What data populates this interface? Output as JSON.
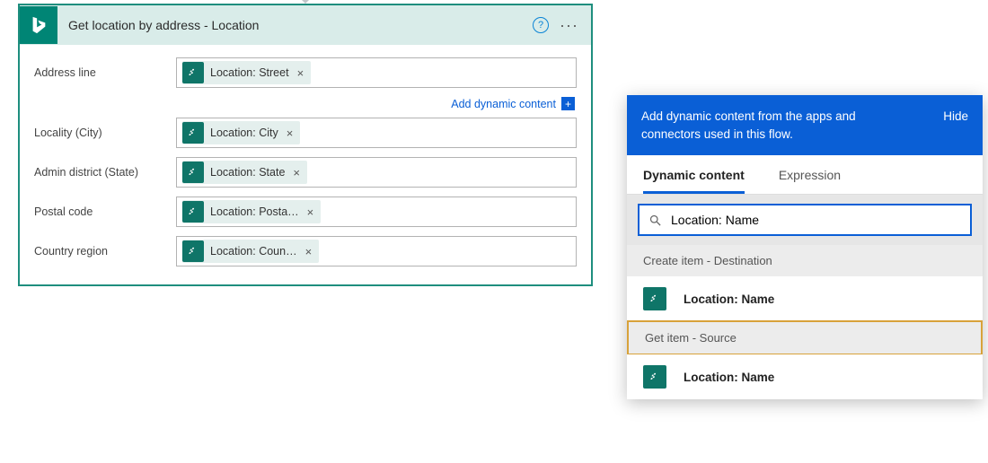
{
  "action": {
    "title": "Get location by address - Location",
    "fields": [
      {
        "label": "Address line",
        "token": "Location: Street"
      },
      {
        "label": "Locality (City)",
        "token": "Location: City"
      },
      {
        "label": "Admin district (State)",
        "token": "Location: State"
      },
      {
        "label": "Postal code",
        "token": "Location: Posta…"
      },
      {
        "label": "Country region",
        "token": "Location: Coun…"
      }
    ],
    "add_dynamic": "Add dynamic content"
  },
  "dc": {
    "header_text": "Add dynamic content from the apps and connectors used in this flow.",
    "hide": "Hide",
    "tabs": {
      "dynamic": "Dynamic content",
      "expression": "Expression"
    },
    "search_value": "Location: Name",
    "sections": [
      {
        "title": "Create item - Destination",
        "items": [
          "Location: Name"
        ],
        "highlight": false
      },
      {
        "title": "Get item - Source",
        "items": [
          "Location: Name"
        ],
        "highlight": true
      }
    ]
  }
}
